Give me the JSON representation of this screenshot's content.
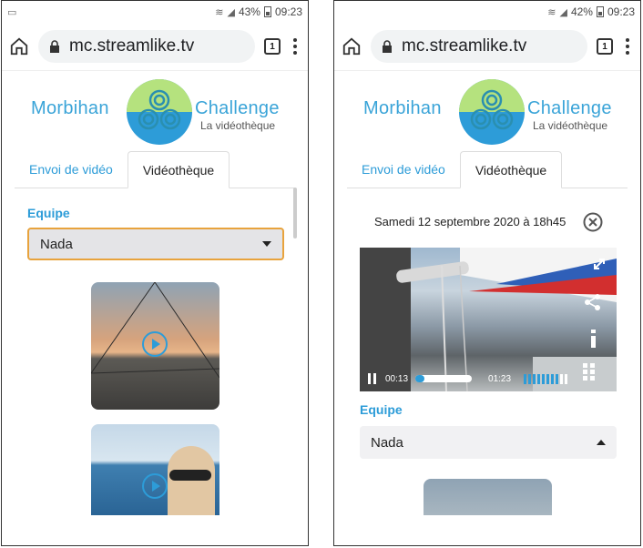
{
  "status": [
    {
      "battery": "43%",
      "time": "09:23"
    },
    {
      "battery": "42%",
      "time": "09:23"
    }
  ],
  "browser": {
    "url": "mc.streamlike.tv",
    "tab_count": "1"
  },
  "logo": {
    "left_word": "Morbihan",
    "right_word": "Challenge",
    "subtitle": "La vidéothèque"
  },
  "tabs": {
    "upload": "Envoi de vidéo",
    "library": "Vidéothèque"
  },
  "filter": {
    "label": "Equipe",
    "value": "Nada"
  },
  "player": {
    "date": "Samedi 12 septembre 2020 à 18h45",
    "elapsed": "00:13",
    "duration": "01:23",
    "progress": 0.16,
    "volume": 0.8
  },
  "colors": {
    "accent": "#2d9cd8",
    "select_focus": "#e8a33d"
  }
}
